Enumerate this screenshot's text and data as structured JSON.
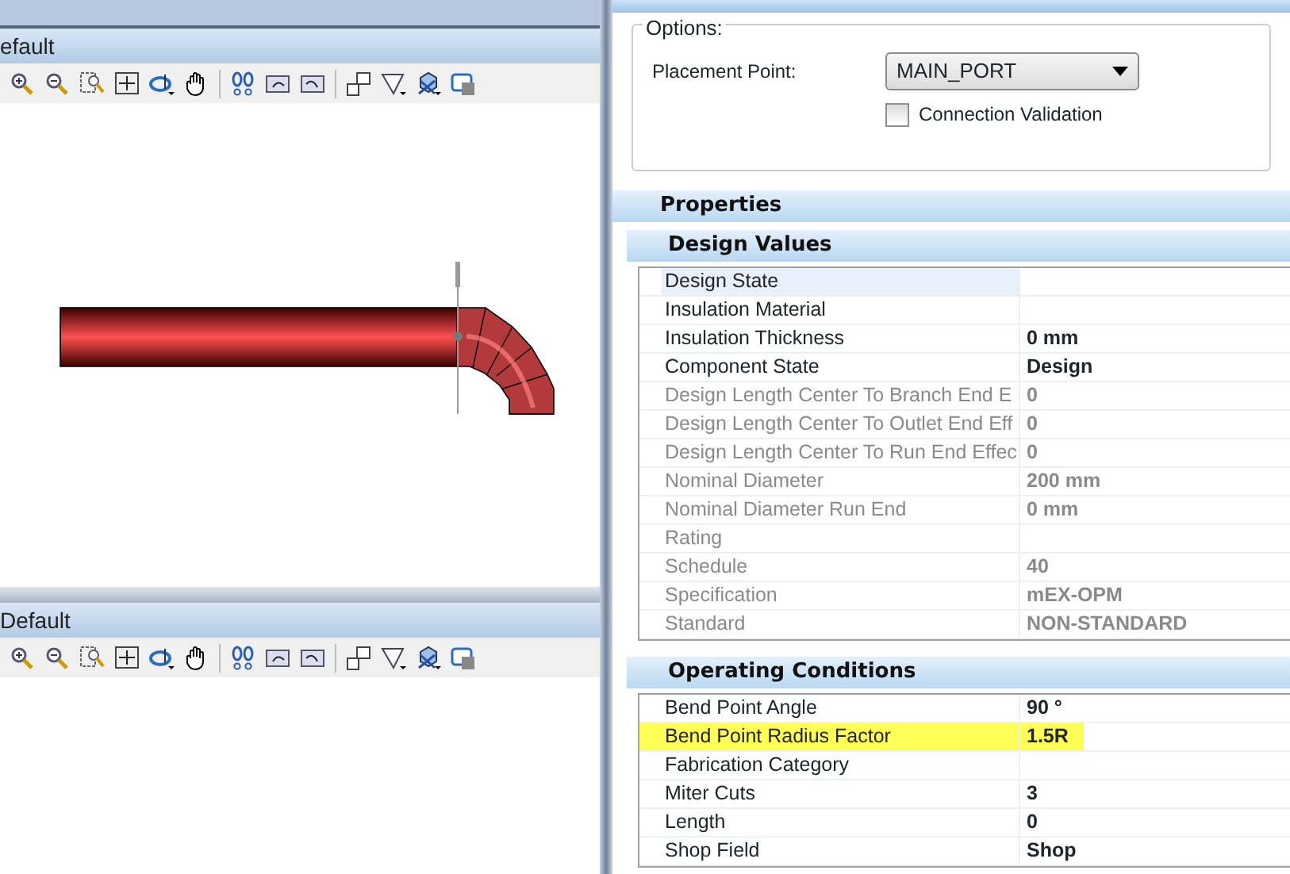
{
  "views": [
    {
      "title": "efault"
    },
    {
      "title": "Default"
    }
  ],
  "settings": {
    "options_label": "Options:",
    "placement_label": "Placement Point:",
    "placement_value": "MAIN_PORT",
    "connection_validation": {
      "label": "Connection Validation",
      "checked": false
    }
  },
  "properties": {
    "title": "Properties",
    "groups": [
      {
        "title": "Design Values",
        "rows": [
          {
            "label": "Design State",
            "selected": true,
            "disabled": false,
            "highlighted": false
          },
          {
            "label": "Insulation Material",
            "selected": false,
            "disabled": false,
            "highlighted": false
          },
          {
            "label": "Insulation Thickness",
            "value": "0 mm",
            "selected": false,
            "disabled": false,
            "highlighted": false
          },
          {
            "label": "Component State",
            "value": "Design",
            "selected": false,
            "disabled": false,
            "highlighted": false
          },
          {
            "label": "Design Length Center To Branch End E",
            "value": "0",
            "selected": false,
            "disabled": true,
            "highlighted": false
          },
          {
            "label": "Design Length Center To Outlet End Eff",
            "value": "0",
            "selected": false,
            "disabled": true,
            "highlighted": false
          },
          {
            "label": "Design Length Center To Run End Effec",
            "value": "0",
            "selected": false,
            "disabled": true,
            "highlighted": false
          },
          {
            "label": "Nominal Diameter",
            "value": "200 mm",
            "selected": false,
            "disabled": true,
            "highlighted": false
          },
          {
            "label": "Nominal Diameter Run End",
            "value": "0 mm",
            "selected": false,
            "disabled": true,
            "highlighted": false
          },
          {
            "label": "Rating",
            "selected": false,
            "disabled": true,
            "highlighted": false
          },
          {
            "label": "Schedule",
            "value": "40",
            "selected": false,
            "disabled": true,
            "highlighted": false
          },
          {
            "label": "Specification",
            "value": "mEX-OPM",
            "selected": false,
            "disabled": true,
            "highlighted": false
          },
          {
            "label": "Standard",
            "value": "NON-STANDARD",
            "selected": false,
            "disabled": true,
            "highlighted": false
          }
        ]
      },
      {
        "title": "Operating Conditions",
        "rows": [
          {
            "label": "Bend Point Angle",
            "value": "90 °",
            "selected": false,
            "disabled": false,
            "highlighted": false
          },
          {
            "label": "Bend Point Radius Factor",
            "value": "1.5R",
            "selected": false,
            "disabled": false,
            "highlighted": true
          },
          {
            "label": "Fabrication Category",
            "selected": false,
            "disabled": false,
            "highlighted": false
          },
          {
            "label": "Miter Cuts",
            "value": "3",
            "selected": false,
            "disabled": false,
            "highlighted": false
          },
          {
            "label": "Length",
            "value": "0",
            "selected": false,
            "disabled": false,
            "highlighted": false
          },
          {
            "label": "Shop Field",
            "value": "Shop",
            "selected": false,
            "disabled": false,
            "highlighted": false
          }
        ]
      }
    ]
  }
}
